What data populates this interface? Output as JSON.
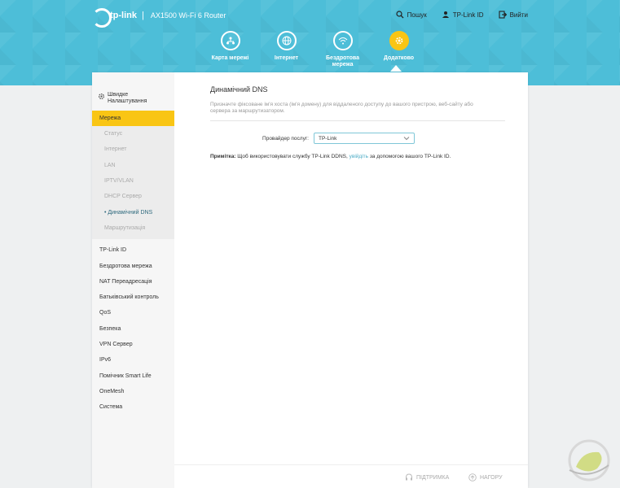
{
  "header": {
    "brand": "tp-link",
    "separator": "|",
    "model": "AX1500 Wi-Fi 6 Router",
    "links": [
      {
        "label": "Пошук",
        "icon": "search-icon"
      },
      {
        "label": "TP-Link ID",
        "icon": "user-icon"
      },
      {
        "label": "Вийти",
        "icon": "logout-icon"
      }
    ],
    "tabs": [
      {
        "label": "Карта мережі",
        "icon": "network-map-icon"
      },
      {
        "label": "Інтернет",
        "icon": "globe-icon"
      },
      {
        "label": "Бездротова мережа",
        "icon": "wifi-icon"
      },
      {
        "label": "Додатково",
        "icon": "gear-icon",
        "active": true
      }
    ]
  },
  "sidebar": {
    "quick_setup": "Швидке Налаштування",
    "active_section": "Мережа",
    "subitems": [
      "Статус",
      "Інтернет",
      "LAN",
      "IPTV/VLAN",
      "DHCP Сервер",
      "• Динамічний DNS",
      "Маршрутизація"
    ],
    "items": [
      "TP-Link ID",
      "Бездротова мережа",
      "NAT Переадресація",
      "Батьківський контроль",
      "QoS",
      "Безпека",
      "VPN Сервер",
      "IPv6",
      "Помічник Smart Life",
      "OneMesh",
      "Система"
    ]
  },
  "content": {
    "title": "Динамічний DNS",
    "description": "Призначте фіксоване ім'я хоста (ім'я домену) для віддаленого доступу до вашого пристрою, веб-сайту або сервера за маршрутизатором.",
    "provider_label": "Провайдер послуг:",
    "provider_value": "TP-Link",
    "note_bold": "Примітка:",
    "note_text_1": " Щоб використовувати службу TP-Link DDNS, ",
    "note_link": "увійдіть",
    "note_text_2": " за допомогою вашого TP-Link ID."
  },
  "footer": {
    "support": "ПІДТРИМКА",
    "up": "НАГОРУ"
  },
  "colors": {
    "header_bg": "#4dbed8",
    "accent": "#f9c514",
    "link": "#4dacc6"
  }
}
